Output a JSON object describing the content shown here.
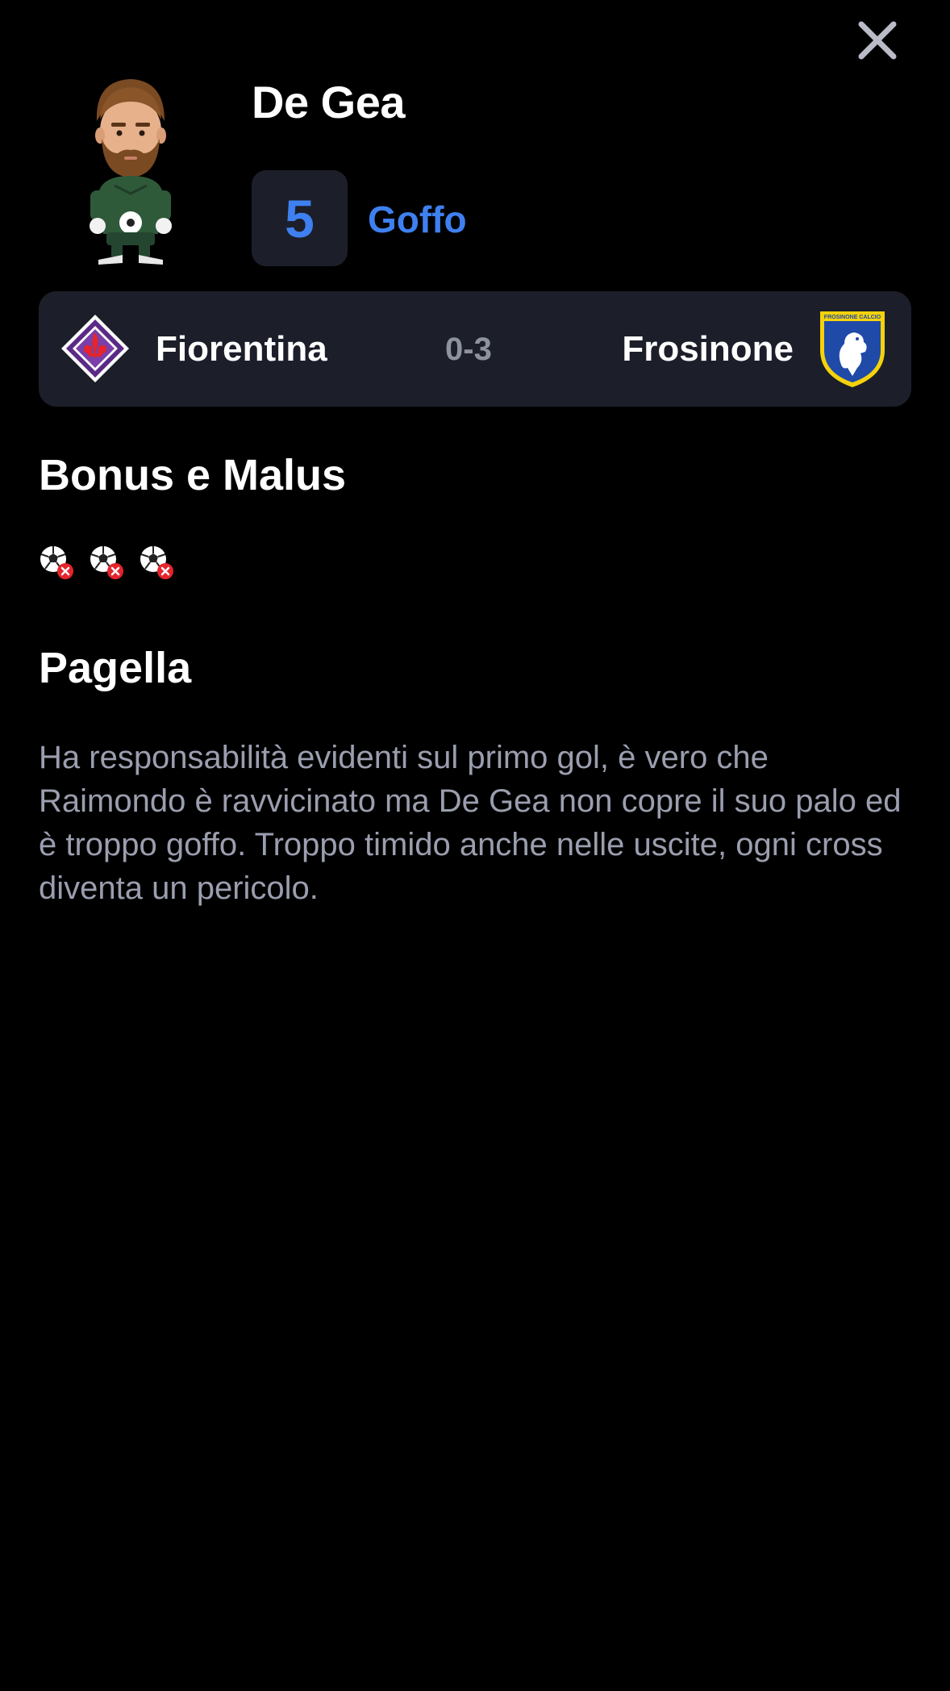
{
  "header": {
    "close_icon": "close-icon",
    "player_name": "De Gea",
    "grade": "5",
    "grade_label": "Goffo"
  },
  "match": {
    "home_team": "Fiorentina",
    "score": "0-3",
    "away_team": "Frosinone",
    "away_logo_text": "FROSINONE CALCIO"
  },
  "bonus_malus": {
    "title": "Bonus e Malus",
    "items": [
      {
        "icon": "goal-conceded-icon"
      },
      {
        "icon": "goal-conceded-icon"
      },
      {
        "icon": "goal-conceded-icon"
      }
    ]
  },
  "pagella": {
    "title": "Pagella",
    "text": "Ha responsabilità evidenti sul primo gol, è vero che Raimondo è ravvicinato ma De Gea non copre il suo palo ed è troppo goffo. Troppo timido anche nelle uscite, ogni cross diventa un pericolo."
  },
  "colors": {
    "background": "#000000",
    "card": "#1c1f29",
    "accent": "#3f80f0",
    "muted_text": "#9a9eae",
    "score_text": "#8d929f",
    "fiorentina_purple": "#5b2a86",
    "malus_red": "#e5242c"
  }
}
